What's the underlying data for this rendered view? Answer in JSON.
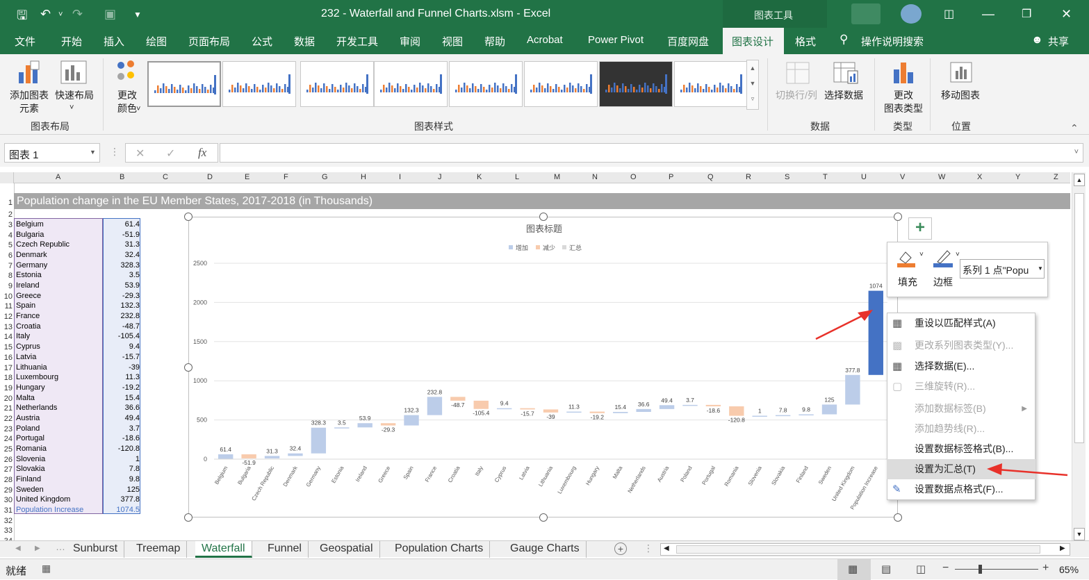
{
  "window": {
    "title": "232 - Waterfall and Funnel Charts.xlsm  -  Excel",
    "context_tab": "图表工具"
  },
  "ribbon_tabs": [
    "文件",
    "开始",
    "插入",
    "绘图",
    "页面布局",
    "公式",
    "数据",
    "开发工具",
    "审阅",
    "视图",
    "帮助",
    "Acrobat",
    "Power Pivot",
    "百度网盘",
    "图表设计",
    "格式"
  ],
  "active_tab": "图表设计",
  "tell_me": "操作说明搜索",
  "share": "共享",
  "ribbon": {
    "add_element": "添加图表\n元素",
    "quick_layout": "快速布局",
    "change_colors": "更改\n颜色",
    "group_layout": "图表布局",
    "group_styles": "图表样式",
    "switch_rowcol": "切换行/列",
    "select_data": "选择数据",
    "group_data": "数据",
    "change_type": "更改\n图表类型",
    "group_type": "类型",
    "move_chart": "移动图表",
    "group_location": "位置"
  },
  "namebox": "图表 1",
  "columns": [
    "A",
    "B",
    "C",
    "D",
    "E",
    "F",
    "G",
    "H",
    "I",
    "J",
    "K",
    "L",
    "M",
    "N",
    "O",
    "P",
    "Q",
    "R",
    "S",
    "T",
    "U",
    "V",
    "W",
    "X",
    "Y",
    "Z"
  ],
  "sheet_title": "Population change in the EU Member States, 2017-2018 (in Thousands)",
  "table": [
    [
      "Belgium",
      "61.4"
    ],
    [
      "Bulgaria",
      "-51.9"
    ],
    [
      "Czech Republic",
      "31.3"
    ],
    [
      "Denmark",
      "32.4"
    ],
    [
      "Germany",
      "328.3"
    ],
    [
      "Estonia",
      "3.5"
    ],
    [
      "Ireland",
      "53.9"
    ],
    [
      "Greece",
      "-29.3"
    ],
    [
      "Spain",
      "132.3"
    ],
    [
      "France",
      "232.8"
    ],
    [
      "Croatia",
      "-48.7"
    ],
    [
      "Italy",
      "-105.4"
    ],
    [
      "Cyprus",
      "9.4"
    ],
    [
      "Latvia",
      "-15.7"
    ],
    [
      "Lithuania",
      "-39"
    ],
    [
      "Luxembourg",
      "11.3"
    ],
    [
      "Hungary",
      "-19.2"
    ],
    [
      "Malta",
      "15.4"
    ],
    [
      "Netherlands",
      "36.6"
    ],
    [
      "Austria",
      "49.4"
    ],
    [
      "Poland",
      "3.7"
    ],
    [
      "Portugal",
      "-18.6"
    ],
    [
      "Romania",
      "-120.8"
    ],
    [
      "Slovenia",
      "1"
    ],
    [
      "Slovakia",
      "7.8"
    ],
    [
      "Finland",
      "9.8"
    ],
    [
      "Sweden",
      "125"
    ],
    [
      "United Kingdom",
      "377.8"
    ],
    [
      "Population Increase",
      "1074.5"
    ]
  ],
  "chart_data": {
    "type": "bar",
    "title": "图表标题",
    "legend": [
      "增加",
      "减少",
      "汇总"
    ],
    "colors": {
      "increase": "#bccde9",
      "decrease": "#f8cbad",
      "total": "#4472c4"
    },
    "ylim": [
      0,
      2500
    ],
    "yticks": [
      "0",
      "500",
      "1000",
      "1500",
      "2000",
      "2500"
    ],
    "categories": [
      "Belgium",
      "Bulgaria",
      "Czech Republic",
      "Denmark",
      "Germany",
      "Estonia",
      "Ireland",
      "Greece",
      "Spain",
      "France",
      "Croatia",
      "Italy",
      "Cyprus",
      "Latvia",
      "Lithuania",
      "Luxembourg",
      "Hungary",
      "Malta",
      "Netherlands",
      "Austria",
      "Poland",
      "Portugal",
      "Romania",
      "Slovenia",
      "Slovakia",
      "Finland",
      "Sweden",
      "United Kingdom",
      "Population Increase"
    ],
    "values": [
      61.4,
      -51.9,
      31.3,
      32.4,
      328.3,
      3.5,
      53.9,
      -29.3,
      132.3,
      232.8,
      -48.7,
      -105.4,
      9.4,
      -15.7,
      -39,
      11.3,
      -19.2,
      15.4,
      36.6,
      49.4,
      3.7,
      -18.6,
      -120.8,
      1,
      7.8,
      9.8,
      125,
      377.8,
      1074.5
    ],
    "labels": [
      "61.4",
      "-51.9",
      "31.3",
      "32.4",
      "328.3",
      "3.5",
      "53.9",
      "-29.3",
      "132.3",
      "232.8",
      "-48.7",
      "-105.4",
      "9.4",
      "-15.7",
      "-39",
      "11.3",
      "-19.2",
      "15.4",
      "36.6",
      "49.4",
      "3.7",
      "-18.6",
      "-120.8",
      "1",
      "7.8",
      "9.8",
      "125",
      "377.8",
      "1074"
    ]
  },
  "format_pane": {
    "fill": "填充",
    "border": "边框",
    "series_select": "系列 1 点\"Popu"
  },
  "context_menu": [
    {
      "label": "重设以匹配样式(A)",
      "enabled": true
    },
    {
      "label": "更改系列图表类型(Y)...",
      "enabled": false
    },
    {
      "label": "选择数据(E)...",
      "enabled": true
    },
    {
      "label": "三维旋转(R)...",
      "enabled": false
    },
    {
      "label": "添加数据标签(B)",
      "enabled": false
    },
    {
      "label": "添加趋势线(R)...",
      "enabled": false
    },
    {
      "label": "设置数据标签格式(B)...",
      "enabled": true
    },
    {
      "label": "设置为汇总(T)",
      "enabled": true
    },
    {
      "label": "设置数据点格式(F)...",
      "enabled": true
    }
  ],
  "sheet_tabs": [
    "Sunburst",
    "Treemap",
    "Waterfall",
    "Funnel",
    "Geospatial",
    "Population Charts",
    "Gauge Charts"
  ],
  "active_sheet": "Waterfall",
  "status": {
    "ready": "就绪",
    "zoom": "65%"
  }
}
